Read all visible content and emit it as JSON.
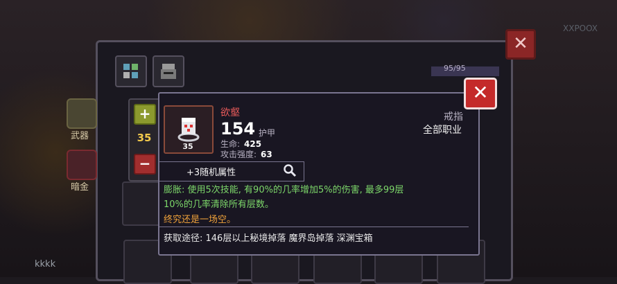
{
  "background": {
    "side_labels": [
      "武器",
      "暗金"
    ],
    "bar_text": "95/95",
    "corner_text": "XXPOOX",
    "player_name": "kkkk"
  },
  "level": {
    "value": "35",
    "plus_label": "+",
    "minus_label": "−"
  },
  "item": {
    "name": "欲壑",
    "icon_level": "35",
    "type": "戒指",
    "class": "全部职业",
    "power": "154",
    "power_label": "护甲",
    "stats": [
      {
        "label": "生命:",
        "value": "425"
      },
      {
        "label": "攻击强度:",
        "value": "63"
      }
    ],
    "random_attr": "+3随机属性",
    "effect_line1": "膨胀: 使用5次技能, 有90%的几率增加5%的伤害, 最多99层",
    "effect_line2": "10%的几率清除所有层数。",
    "flavor": "终究还是一场空。",
    "source": "获取途径: 146层以上秘境掉落 魔界岛掉落 深渊宝箱"
  },
  "buttons": {
    "close_symbol": "✕"
  },
  "colors": {
    "name": "#e85a5a",
    "effect": "#7dd86a",
    "flavor": "#f0a23a",
    "level": "#f2c94c"
  }
}
